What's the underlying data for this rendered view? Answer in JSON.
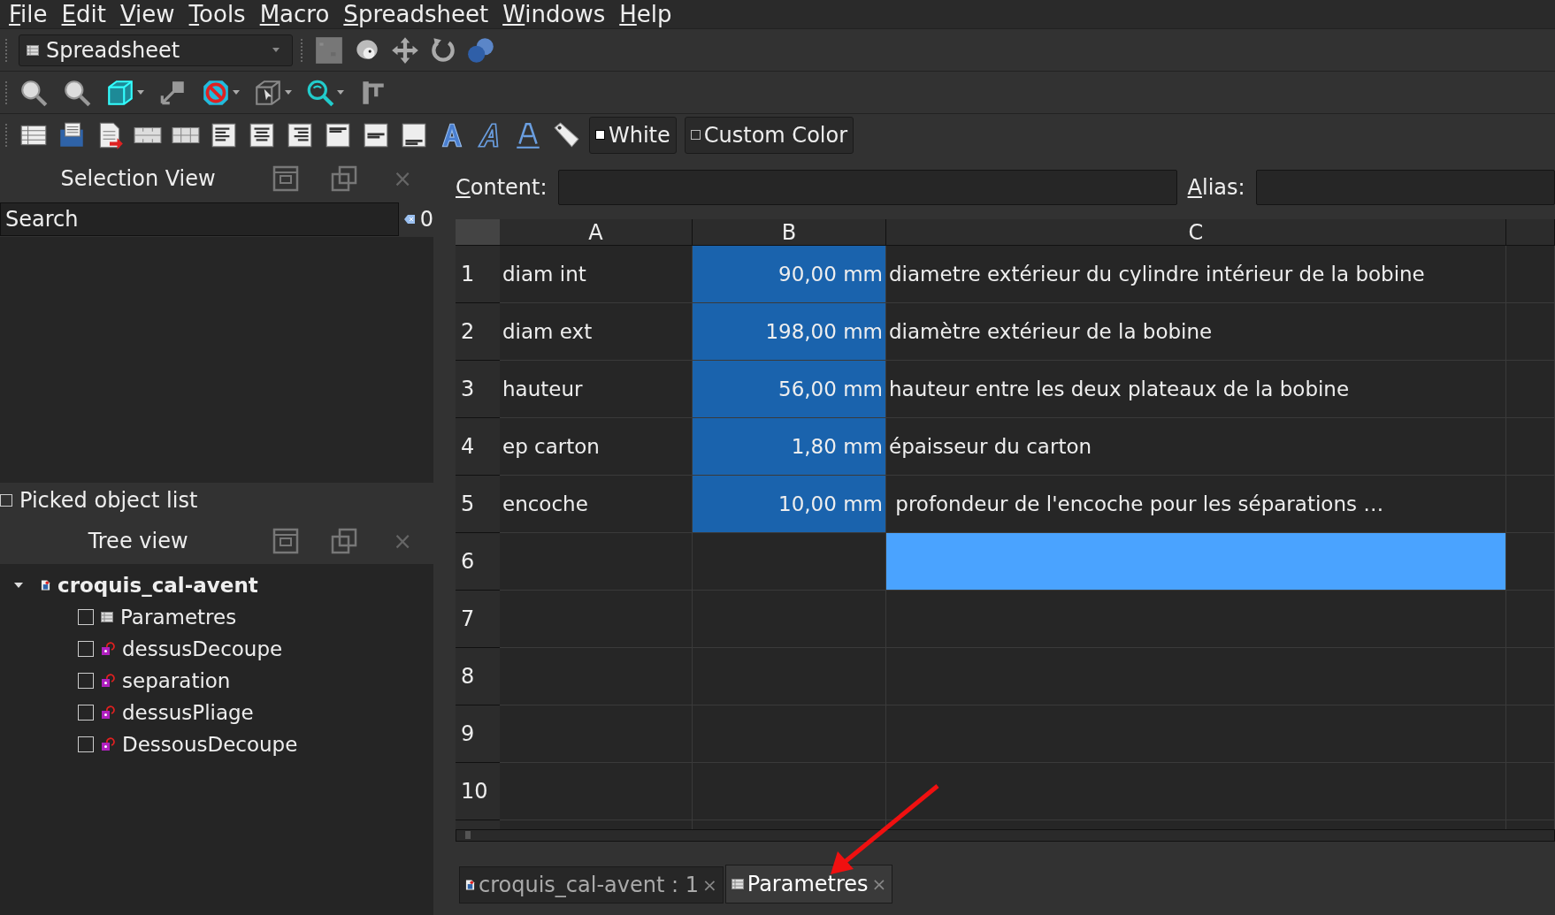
{
  "menu": [
    "File",
    "Edit",
    "View",
    "Tools",
    "Macro",
    "Spreadsheet",
    "Windows",
    "Help"
  ],
  "workbench": {
    "label": "Spreadsheet"
  },
  "style_buttons": [
    {
      "label": "White",
      "kind": "filled"
    },
    {
      "label": "Custom Color",
      "kind": "outline"
    }
  ],
  "selection_view": {
    "title": "Selection View",
    "close": "×",
    "search": {
      "placeholder": "Search"
    },
    "count": "0"
  },
  "picked_list": {
    "label": "Picked object list",
    "checked": false
  },
  "tree_view": {
    "title": "Tree view",
    "close": "×",
    "items": [
      {
        "label": "croquis_cal-avent",
        "kind": "document",
        "expanded": true,
        "children": [
          {
            "label": "Parametres",
            "kind": "spreadsheet",
            "checked": false
          },
          {
            "label": "dessusDecoupe",
            "kind": "part",
            "checked": false
          },
          {
            "label": "separation",
            "kind": "part",
            "checked": false
          },
          {
            "label": "dessusPliage",
            "kind": "part",
            "checked": false
          },
          {
            "label": "DessousDecoupe",
            "kind": "part",
            "checked": false
          }
        ]
      }
    ]
  },
  "editor": {
    "content_label": "Content:",
    "alias_label": "Alias:"
  },
  "sheet": {
    "columns": [
      "A",
      "B",
      "C"
    ],
    "rows": [
      {
        "number": "1",
        "cells": [
          {
            "text": "diam int",
            "selected": false,
            "current": false
          },
          {
            "text": "90,00 mm",
            "selected": true,
            "current": false
          },
          {
            "text": "diametre extérieur du cylindre intérieur de la bobine",
            "selected": false,
            "current": false
          }
        ]
      },
      {
        "number": "2",
        "cells": [
          {
            "text": "diam ext",
            "selected": false,
            "current": false
          },
          {
            "text": "198,00 mm",
            "selected": true,
            "current": false
          },
          {
            "text": "diamètre extérieur de la bobine",
            "selected": false,
            "current": false
          }
        ]
      },
      {
        "number": "3",
        "cells": [
          {
            "text": "hauteur",
            "selected": false,
            "current": false
          },
          {
            "text": "56,00 mm",
            "selected": true,
            "current": false
          },
          {
            "text": "hauteur entre les deux plateaux de la bobine",
            "selected": false,
            "current": false
          }
        ]
      },
      {
        "number": "4",
        "cells": [
          {
            "text": "ep carton",
            "selected": false,
            "current": false
          },
          {
            "text": "1,80 mm",
            "selected": true,
            "current": false
          },
          {
            "text": "épaisseur du carton",
            "selected": false,
            "current": false
          }
        ]
      },
      {
        "number": "5",
        "cells": [
          {
            "text": "encoche",
            "selected": false,
            "current": false
          },
          {
            "text": "10,00 mm",
            "selected": true,
            "current": false
          },
          {
            "text": " profondeur de l'encoche pour les séparations …",
            "selected": false,
            "current": false
          }
        ]
      },
      {
        "number": "6",
        "cells": [
          {
            "selected": false,
            "current": false
          },
          {
            "selected": false,
            "current": false
          },
          {
            "selected": false,
            "current": true
          }
        ]
      },
      {
        "number": "7",
        "cells": [
          {
            "selected": false,
            "current": false
          },
          {
            "selected": false,
            "current": false
          },
          {
            "selected": false,
            "current": false
          }
        ]
      },
      {
        "number": "8",
        "cells": [
          {
            "selected": false,
            "current": false
          },
          {
            "selected": false,
            "current": false
          },
          {
            "selected": false,
            "current": false
          }
        ]
      },
      {
        "number": "9",
        "cells": [
          {
            "selected": false,
            "current": false
          },
          {
            "selected": false,
            "current": false
          },
          {
            "selected": false,
            "current": false
          }
        ]
      },
      {
        "number": "10",
        "cells": [
          {
            "selected": false,
            "current": false
          },
          {
            "selected": false,
            "current": false
          },
          {
            "selected": false,
            "current": false
          }
        ]
      }
    ]
  },
  "tabs": [
    {
      "label": "croquis_cal-avent : 1",
      "kind": "document",
      "close": "×",
      "selected": false
    },
    {
      "label": "Parametres",
      "kind": "spreadsheet",
      "close": "×",
      "selected": true
    }
  ]
}
